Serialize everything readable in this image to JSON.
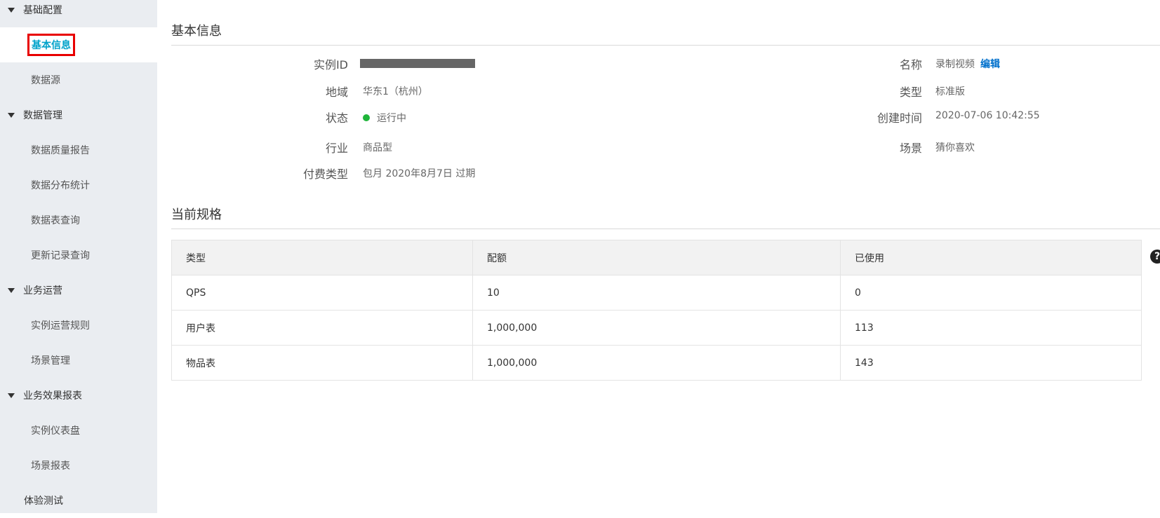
{
  "sidebar": {
    "groups": [
      {
        "label": "基础配置",
        "items": [
          "基本信息",
          "数据源"
        ]
      },
      {
        "label": "数据管理",
        "items": [
          "数据质量报告",
          "数据分布统计",
          "数据表查询",
          "更新记录查询"
        ]
      },
      {
        "label": "业务运营",
        "items": [
          "实例运营规则",
          "场景管理"
        ]
      },
      {
        "label": "业务效果报表",
        "items": [
          "实例仪表盘",
          "场景报表"
        ]
      }
    ],
    "active_item": "基本信息",
    "plain_item": "体验测试"
  },
  "basic_info": {
    "title": "基本信息",
    "instance_id_label": "实例ID",
    "region_label": "地域",
    "region_value": "华东1（杭州）",
    "status_label": "状态",
    "status_value": "运行中",
    "industry_label": "行业",
    "industry_value": "商品型",
    "billing_label": "付费类型",
    "billing_value": "包月  2020年8月7日 过期",
    "name_label": "名称",
    "name_value": "录制视频",
    "edit_label": "编辑",
    "type_label": "类型",
    "type_value": "标准版",
    "created_label": "创建时间",
    "created_value": "2020-07-06 10:42:55",
    "scene_label": "场景",
    "scene_value": "猜你喜欢"
  },
  "spec": {
    "title": "当前规格",
    "headers": [
      "类型",
      "配额",
      "已使用"
    ],
    "rows": [
      [
        "QPS",
        "10",
        "0"
      ],
      [
        "用户表",
        "1,000,000",
        "113"
      ],
      [
        "物品表",
        "1,000,000",
        "143"
      ]
    ]
  },
  "colors": {
    "sidebar_bg": "#eaedf1",
    "active_text": "#00a2ca",
    "highlight_border": "#e80000",
    "status_running": "#1fb53a",
    "link": "#0070cc"
  },
  "icons": [
    "caret-down-icon",
    "status-dot-icon",
    "help-icon"
  ]
}
